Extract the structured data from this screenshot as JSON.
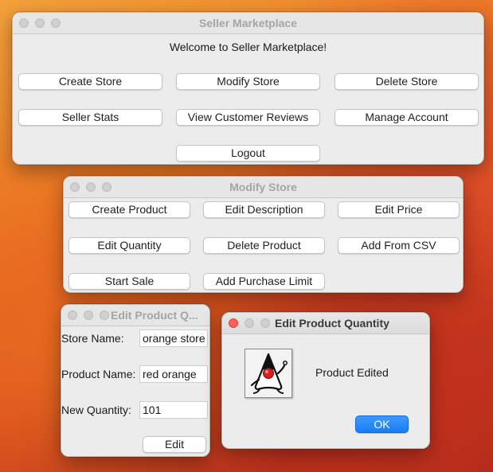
{
  "main_window": {
    "title": "Seller Marketplace",
    "welcome": "Welcome to Seller Marketplace!",
    "buttons": {
      "create_store": "Create Store",
      "modify_store": "Modify Store",
      "delete_store": "Delete Store",
      "seller_stats": "Seller Stats",
      "view_reviews": "View Customer Reviews",
      "manage_account": "Manage Account",
      "logout": "Logout"
    }
  },
  "modify_window": {
    "title": "Modify Store",
    "buttons": {
      "create_product": "Create Product",
      "edit_description": "Edit Description",
      "edit_price": "Edit Price",
      "edit_quantity": "Edit Quantity",
      "delete_product": "Delete Product",
      "add_from_csv": "Add From CSV",
      "start_sale": "Start Sale",
      "add_purchase_limit": "Add Purchase Limit"
    }
  },
  "edit_window": {
    "title": "Edit Product Q...",
    "store_name_label": "Store Name:",
    "store_name_value": "orange store",
    "product_name_label": "Product Name:",
    "product_name_value": "red orange",
    "new_quantity_label": "New Quantity:",
    "new_quantity_value": "101",
    "edit_button": "Edit"
  },
  "dialog": {
    "title": "Edit Product Quantity",
    "icon": "java-duke-icon",
    "message": "Product Edited",
    "ok_button": "OK"
  },
  "colors": {
    "accent": "#1a7cf5",
    "close_red": "#fe5f57"
  }
}
